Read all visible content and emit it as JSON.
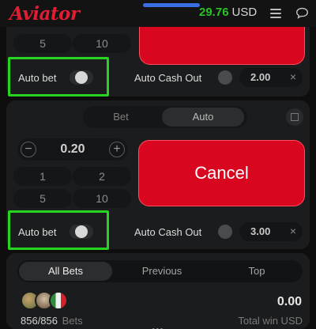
{
  "header": {
    "logo": "Aviator",
    "balance": "29.76",
    "currency": "USD",
    "menu_icon": "hamburger-icon",
    "chat_icon": "chat-icon"
  },
  "colors": {
    "brand_red": "#d9061f",
    "balance_green": "#28c325",
    "highlight_green": "#27d420"
  },
  "panel1": {
    "quick_amounts": [
      "5",
      "10"
    ],
    "auto_bet_label": "Auto bet",
    "auto_bet_on": false,
    "auto_cashout_label": "Auto Cash Out",
    "auto_cashout_on": false,
    "cashout_value": "2.00",
    "clear_symbol": "×"
  },
  "panel2": {
    "tabs": [
      "Bet",
      "Auto"
    ],
    "active_tab": "Auto",
    "minus_symbol": "−",
    "plus_symbol": "+",
    "bet_amount": "0.20",
    "quick_amounts": [
      "1",
      "2",
      "5",
      "10"
    ],
    "cancel_label": "Cancel",
    "auto_bet_label": "Auto bet",
    "auto_bet_on": false,
    "auto_cashout_label": "Auto Cash Out",
    "auto_cashout_on": false,
    "cashout_value": "3.00",
    "clear_symbol": "×"
  },
  "bets": {
    "tabs": [
      "All Bets",
      "Previous",
      "Top"
    ],
    "active_tab": "All Bets",
    "bets_count": "856/856",
    "bets_word": "Bets",
    "total_win": "0.00",
    "total_win_label": "Total win USD",
    "pager_dots": "•••"
  }
}
